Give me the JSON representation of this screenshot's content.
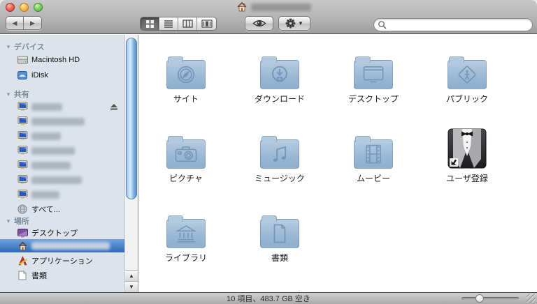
{
  "titlebar": {
    "title": "",
    "title_redacted": true
  },
  "toolbar": {
    "view_modes": [
      "icon",
      "list",
      "column",
      "coverflow"
    ],
    "selected_view": "icon",
    "search_value": "",
    "search_placeholder": ""
  },
  "sidebar": {
    "sections": [
      {
        "label": "デバイス",
        "items": [
          {
            "label": "Macintosh HD",
            "icon": "hard-drive"
          },
          {
            "label": "iDisk",
            "icon": "idisk"
          }
        ]
      },
      {
        "label": "共有",
        "items": [
          {
            "label": "",
            "redacted": true,
            "icon": "shared-computer",
            "eject": true
          },
          {
            "label": "",
            "redacted": true,
            "icon": "shared-computer"
          },
          {
            "label": "",
            "redacted": true,
            "icon": "shared-computer"
          },
          {
            "label": "",
            "redacted": true,
            "icon": "shared-computer"
          },
          {
            "label": "",
            "redacted": true,
            "icon": "shared-computer"
          },
          {
            "label": "",
            "redacted": true,
            "icon": "shared-computer"
          },
          {
            "label": "",
            "redacted": true,
            "icon": "shared-computer"
          },
          {
            "label": "すべて...",
            "icon": "globe"
          }
        ]
      },
      {
        "label": "場所",
        "items": [
          {
            "label": "デスクトップ",
            "icon": "desktop"
          },
          {
            "label": "",
            "redacted": true,
            "icon": "home",
            "selected": true
          },
          {
            "label": "アプリケーション",
            "icon": "applications"
          },
          {
            "label": "書類",
            "icon": "document"
          }
        ]
      }
    ]
  },
  "content": {
    "items": [
      {
        "label": "サイト",
        "kind": "folder",
        "emblem": "compass"
      },
      {
        "label": "ダウンロード",
        "kind": "folder",
        "emblem": "download"
      },
      {
        "label": "デスクトップ",
        "kind": "folder",
        "emblem": "display"
      },
      {
        "label": "パブリック",
        "kind": "folder",
        "emblem": "public-sign"
      },
      {
        "label": "ピクチャ",
        "kind": "folder",
        "emblem": "camera"
      },
      {
        "label": "ミュージック",
        "kind": "folder",
        "emblem": "music-note"
      },
      {
        "label": "ムービー",
        "kind": "folder",
        "emblem": "film-strip"
      },
      {
        "label": "ユーザ登録",
        "kind": "alias",
        "emblem": "tuxedo"
      },
      {
        "label": "ライブラリ",
        "kind": "folder",
        "emblem": "library-building"
      },
      {
        "label": "書類",
        "kind": "folder",
        "emblem": "document-page"
      }
    ]
  },
  "statusbar": {
    "text": "10 項目、483.7 GB 空き"
  },
  "colors": {
    "selection_blue": "#3068b8",
    "sidebar_bg": "#dce3ea",
    "folder_blue_top": "#b7cde1",
    "folder_blue_bottom": "#8db0cd"
  }
}
